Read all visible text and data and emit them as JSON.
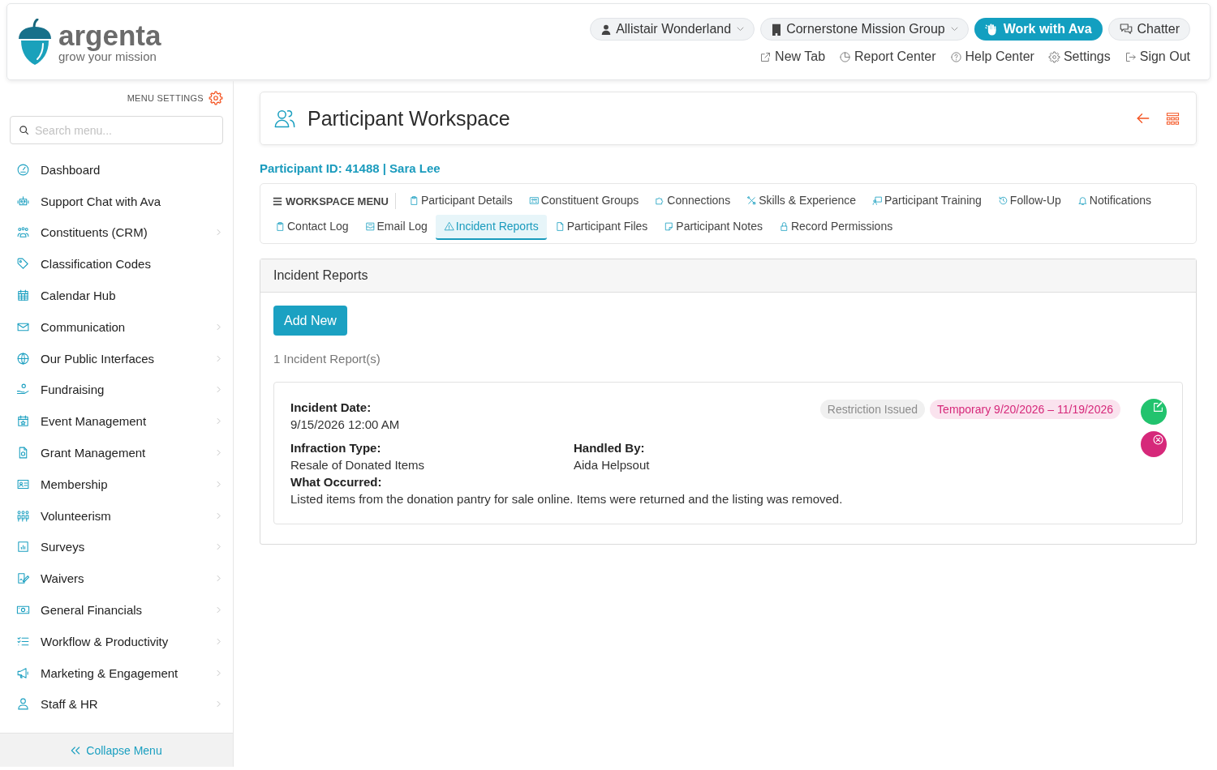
{
  "header": {
    "logo": {
      "wordmark": "argenta",
      "tagline": "grow your mission"
    },
    "account_menu": {
      "label": "Allistair Wonderland"
    },
    "organization_menu": {
      "label": "Cornerstone Mission Group"
    },
    "ai_button": {
      "label": "Work with Ava"
    },
    "chat_button": {
      "label": "Chatter"
    },
    "links": [
      {
        "label": "New Tab"
      },
      {
        "label": "Report Center"
      },
      {
        "label": "Help Center"
      },
      {
        "label": "Settings"
      },
      {
        "label": "Sign Out"
      }
    ]
  },
  "sidebar": {
    "settings_label": "MENU SETTINGS",
    "search": {
      "placeholder": "Search menu..."
    },
    "items": [
      {
        "label": "Dashboard",
        "has_submenu": false
      },
      {
        "label": "Support Chat with Ava",
        "has_submenu": false
      },
      {
        "label": "Constituents (CRM)",
        "has_submenu": true
      },
      {
        "label": "Classification Codes",
        "has_submenu": false
      },
      {
        "label": "Calendar Hub",
        "has_submenu": false
      },
      {
        "label": "Communication",
        "has_submenu": true
      },
      {
        "label": "Our Public Interfaces",
        "has_submenu": true
      },
      {
        "label": "Fundraising",
        "has_submenu": true
      },
      {
        "label": "Event Management",
        "has_submenu": true
      },
      {
        "label": "Grant Management",
        "has_submenu": true
      },
      {
        "label": "Membership",
        "has_submenu": true
      },
      {
        "label": "Volunteerism",
        "has_submenu": true
      },
      {
        "label": "Surveys",
        "has_submenu": true
      },
      {
        "label": "Waivers",
        "has_submenu": true
      },
      {
        "label": "General Financials",
        "has_submenu": true
      },
      {
        "label": "Workflow & Productivity",
        "has_submenu": true
      },
      {
        "label": "Marketing & Engagement",
        "has_submenu": true
      },
      {
        "label": "Staff & HR",
        "has_submenu": true
      }
    ],
    "collapse_label": "Collapse Menu"
  },
  "workspace": {
    "title": "Participant Workspace",
    "participant_line": "Participant ID: 41488 | Sara Lee",
    "menu": {
      "title": "WORKSPACE MENU",
      "tab_rows": [
        [
          {
            "label": "Participant Details",
            "selected": false
          },
          {
            "label": "Constituent Groups",
            "selected": false
          },
          {
            "label": "Connections",
            "selected": false
          },
          {
            "label": "Skills & Experience",
            "selected": false
          },
          {
            "label": "Participant Training",
            "selected": false
          },
          {
            "label": "Follow-Up",
            "selected": false
          },
          {
            "label": "Notifications",
            "selected": false
          }
        ],
        [
          {
            "label": "Contact Log",
            "selected": false
          },
          {
            "label": "Email Log",
            "selected": false
          },
          {
            "label": "Incident Reports",
            "selected": true
          },
          {
            "label": "Participant Files",
            "selected": false
          },
          {
            "label": "Participant Notes",
            "selected": false
          },
          {
            "label": "Record Permissions",
            "selected": false
          }
        ]
      ]
    }
  },
  "incident_reports": {
    "title": "Incident Reports",
    "add_button": "Add New",
    "count": "1 Incident Report(s)",
    "reports": [
      {
        "date": {
          "label": "Incident Date:",
          "value": "9/15/2026 12:00 AM"
        },
        "details": [
          {
            "label": "Infraction Type:",
            "value": "Resale of Donated Items"
          },
          {
            "label": "Handled By:",
            "value": "Aida Helpsout"
          }
        ],
        "occurred": {
          "label": "What Occurred:",
          "value": "Listed items from the donation pantry for sale online. Items were returned and the listing was removed."
        },
        "badges": [
          {
            "text": "Restriction Issued",
            "color": "#8c8c8c"
          },
          {
            "text": "Temporary 9/20/2026 – 11/19/2026",
            "color": "#d6287a"
          }
        ]
      }
    ]
  }
}
